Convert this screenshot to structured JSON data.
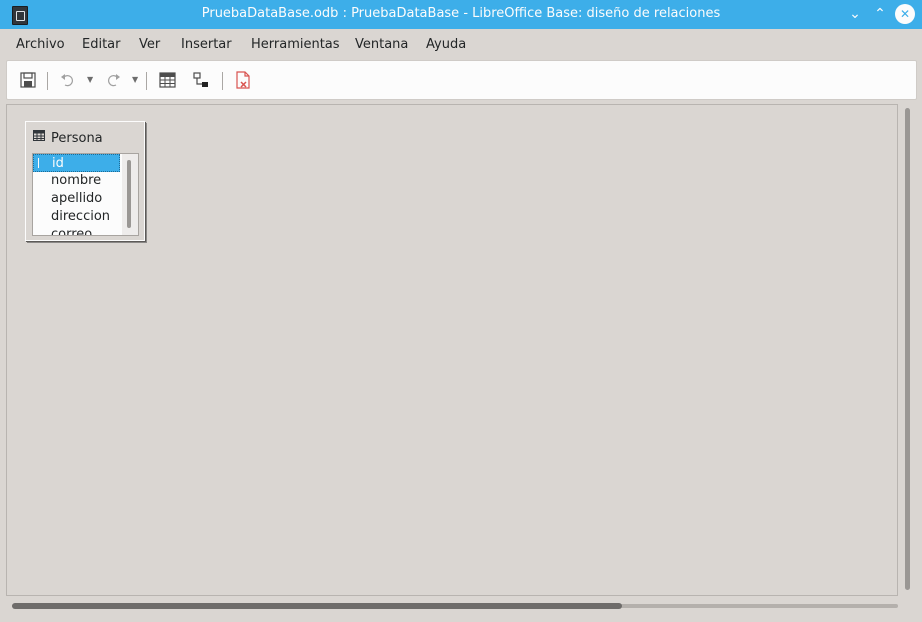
{
  "window": {
    "title": "PruebaDataBase.odb : PruebaDataBase - LibreOffice Base: diseño de relaciones"
  },
  "menu": [
    "Archivo",
    "Editar",
    "Ver",
    "Insertar",
    "Herramientas",
    "Ventana",
    "Ayuda"
  ],
  "toolbar": {
    "icons": [
      "save-icon",
      "undo-icon",
      "redo-icon",
      "add-tables-icon",
      "new-relation-icon",
      "delete-icon"
    ]
  },
  "relation_design": {
    "tables": [
      {
        "name": "Persona",
        "fields": [
          "id",
          "nombre",
          "apellido",
          "direccion",
          "correo"
        ],
        "selected_field": "id"
      }
    ]
  },
  "colors": {
    "titlebar": "#3daee9",
    "window_bg": "#dad6d2",
    "selection": "#3daee9"
  }
}
